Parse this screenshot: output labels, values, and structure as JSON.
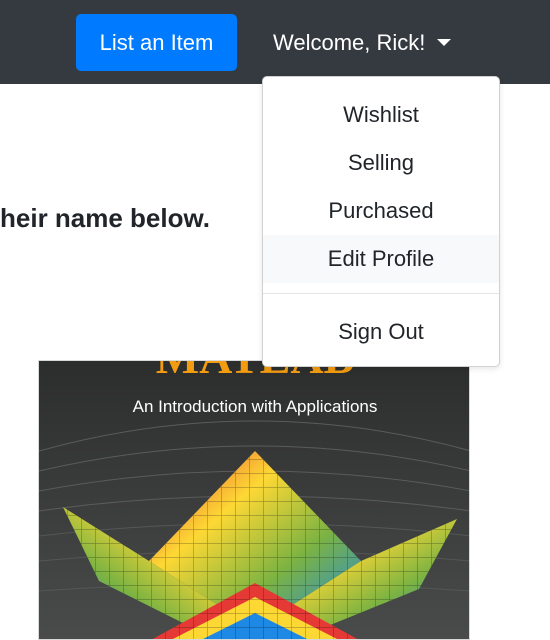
{
  "navbar": {
    "list_item_label": "List an Item",
    "welcome_label": "Welcome, Rick!"
  },
  "main": {
    "heading_partial": "heir name below.",
    "book_cover": {
      "title_partial": "MATLAB",
      "subtitle": "An Introduction with Applications"
    }
  },
  "dropdown": {
    "items": [
      {
        "label": "Wishlist"
      },
      {
        "label": "Selling"
      },
      {
        "label": "Purchased"
      },
      {
        "label": "Edit Profile"
      }
    ],
    "sign_out_label": "Sign Out"
  },
  "colors": {
    "navbar_bg": "#343a40",
    "primary_button": "#007bff",
    "dropdown_hover": "#f8f9fa"
  }
}
